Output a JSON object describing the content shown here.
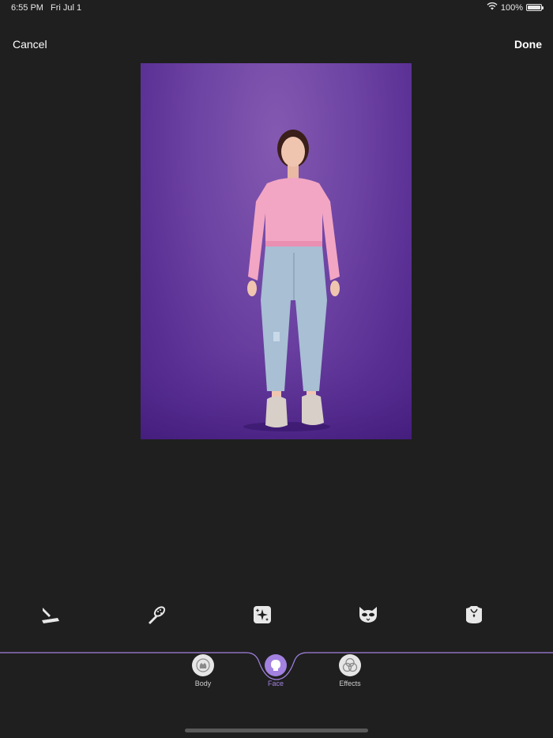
{
  "status_bar": {
    "time": "6:55 PM",
    "date": "Fri Jul 1",
    "battery_text": "100%",
    "battery_level": 1.0,
    "icons": [
      "wifi-icon",
      "battery-icon"
    ]
  },
  "nav": {
    "cancel_label": "Cancel",
    "done_label": "Done"
  },
  "colors": {
    "background": "#1f1f1f",
    "accent": "#a281e0",
    "photo_backdrop": "#6e44a4"
  },
  "tools": [
    {
      "icon": "razor-icon"
    },
    {
      "icon": "brush-icon"
    },
    {
      "icon": "sparkle-square-icon"
    },
    {
      "icon": "mask-icon"
    },
    {
      "icon": "necklace-icon"
    }
  ],
  "tabs": [
    {
      "label": "Body",
      "icon": "body-icon",
      "active": false
    },
    {
      "label": "Face",
      "icon": "face-icon",
      "active": true
    },
    {
      "label": "Effects",
      "icon": "effects-icon",
      "active": false
    }
  ]
}
